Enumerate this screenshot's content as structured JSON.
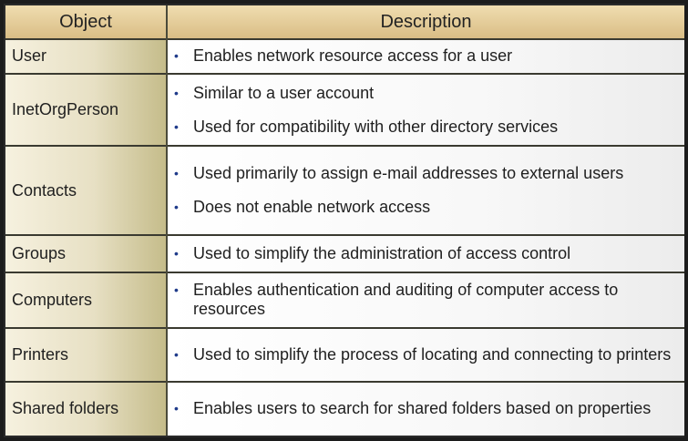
{
  "table": {
    "headers": {
      "object": "Object",
      "description": "Description"
    },
    "rows": [
      {
        "object": "User",
        "items": [
          "Enables network resource access for a user"
        ]
      },
      {
        "object": "InetOrgPerson",
        "items": [
          "Similar to a user account",
          "Used for compatibility with other directory services"
        ]
      },
      {
        "object": "Contacts",
        "items": [
          "Used primarily to assign e-mail addresses to external users",
          "Does not enable network access"
        ]
      },
      {
        "object": "Groups",
        "items": [
          "Used to simplify the administration of access control"
        ]
      },
      {
        "object": "Computers",
        "items": [
          "Enables authentication and auditing of computer access to resources"
        ]
      },
      {
        "object": "Printers",
        "items": [
          "Used to simplify the process of locating and connecting to printers"
        ]
      },
      {
        "object": "Shared folders",
        "items": [
          "Enables users to search for shared folders based on properties"
        ]
      }
    ]
  },
  "colors": {
    "header_gold": "#d9bd85",
    "object_column": "#e7e0c4",
    "bullet": "#1f3b8a"
  }
}
